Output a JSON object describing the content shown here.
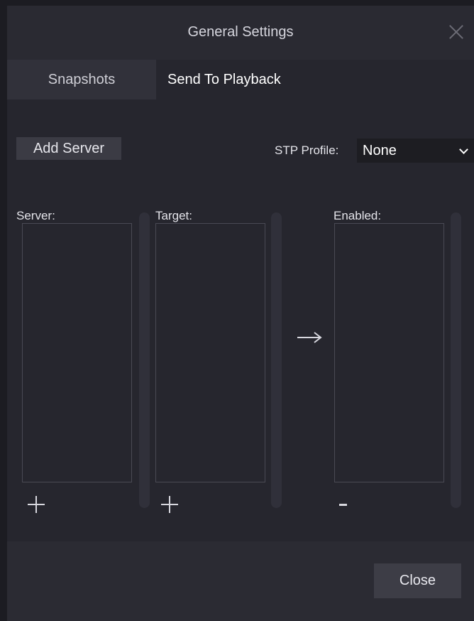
{
  "dialog": {
    "title": "General Settings",
    "close_icon": "close-x-icon"
  },
  "tabs": [
    {
      "label": "Snapshots",
      "active": false
    },
    {
      "label": "Send To Playback",
      "active": true
    }
  ],
  "toolbar": {
    "add_server_label": "Add Server",
    "stp_profile_label": "STP Profile:",
    "stp_profile_value": "None"
  },
  "columns": {
    "server_label": "Server:",
    "target_label": "Target:",
    "enabled_label": "Enabled:"
  },
  "icons": {
    "add": "plus-icon",
    "remove": "minus-icon",
    "move": "arrow-right-icon"
  },
  "footer": {
    "close_label": "Close"
  },
  "colors": {
    "background": "#26262e",
    "titlebar": "#2a2a32",
    "button": "#3d3d46",
    "dropdown": "#1d1d22",
    "border": "#4a4a54"
  }
}
